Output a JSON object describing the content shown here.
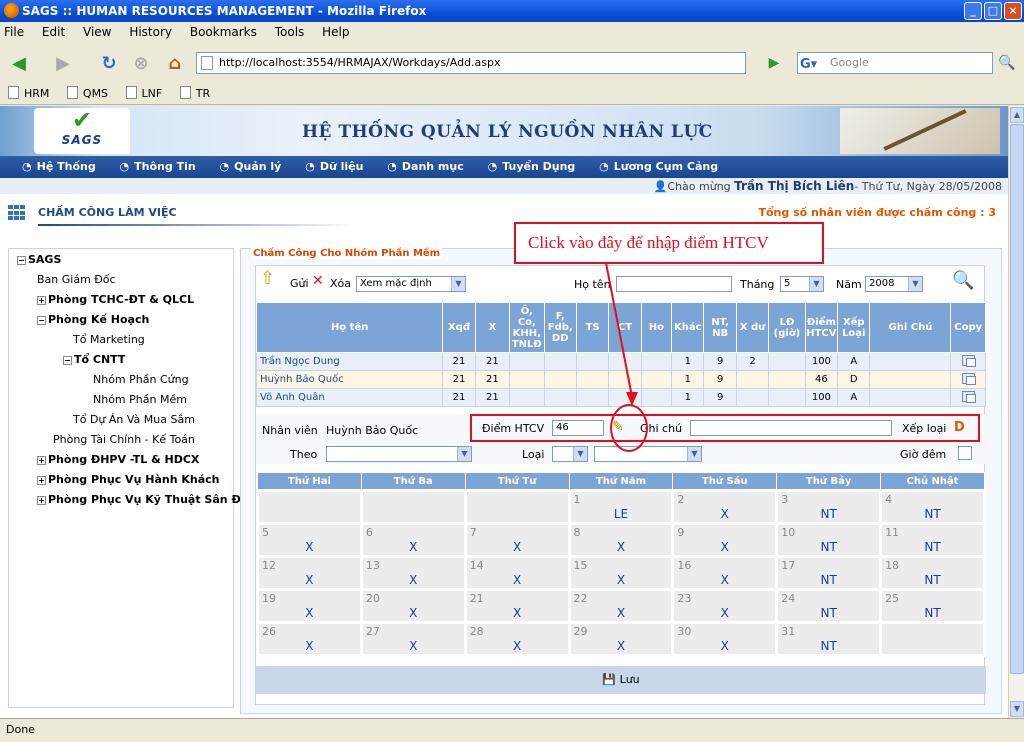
{
  "window": {
    "title": "SAGS :: HUMAN RESOURCES MANAGEMENT - Mozilla Firefox"
  },
  "menu": [
    "File",
    "Edit",
    "View",
    "History",
    "Bookmarks",
    "Tools",
    "Help"
  ],
  "address": {
    "url": "http://localhost:3554/HRMAJAX/Workdays/Add.aspx",
    "search_placeholder": "Google"
  },
  "bookmarks": [
    "HRM",
    "QMS",
    "LNF",
    "TR"
  ],
  "status": "Done",
  "banner": {
    "logo": "SAGS",
    "title": "HỆ THỐNG QUẢN LÝ NGUỒN NHÂN LỰC"
  },
  "topnav": [
    "Hệ Thống",
    "Thông Tin",
    "Quản lý",
    "Dữ liệu",
    "Danh mục",
    "Tuyển Dụng",
    "Lương Cụm Cảng"
  ],
  "welcome": {
    "prefix": "Chào mừng ",
    "name": "Trần Thị Bích Liên",
    "suffix": "- Thứ Tư, Ngày 28/05/2008"
  },
  "page": {
    "title": "CHẤM CÔNG LÀM VIỆC",
    "count_label": "Tổng số nhân viên được chấm công : 3"
  },
  "tree": [
    "SAGS",
    "Ban Giám Đốc",
    "Phòng TCHC-ĐT & QLCL",
    "Phòng Kế Hoạch",
    "Tổ Marketing",
    "Tổ CNTT",
    "Nhóm Phần Cứng",
    "Nhóm Phần Mềm",
    "Tổ Dự Án Và Mua Sắm",
    "Phòng Tài Chính - Kế Toán",
    "Phòng ĐHPV -TL & HDCX",
    "Phòng Phục Vụ Hành Khách",
    "Phòng Phục Vụ Kỹ Thuật Sân Đỗ"
  ],
  "panel": {
    "legend": "Chấm Công Cho Nhóm Phần Mềm",
    "send": "Gửi",
    "delete": "Xóa",
    "view_select": "Xem mặc định",
    "name_label": "Họ tên",
    "month_label": "Tháng",
    "month": "5",
    "year_label": "Năm",
    "year": "2008"
  },
  "table": {
    "headers": [
      "Họ tên",
      "Xqđ",
      "X",
      "Ô, Co, KHH, TNLĐ",
      "F, Fdb, DD",
      "TS",
      "CT",
      "Ho",
      "Khác",
      "NT, NB",
      "X dư",
      "LĐ (giờ)",
      "Điểm HTCV",
      "Xếp Loại",
      "Ghi Chú",
      "Copy"
    ],
    "rows": [
      [
        "Trần Ngọc Dung",
        "21",
        "21",
        "",
        "",
        "",
        "",
        "",
        "1",
        "9",
        "2",
        "",
        "100",
        "A",
        ""
      ],
      [
        "Huỳnh Bảo Quốc",
        "21",
        "21",
        "",
        "",
        "",
        "",
        "",
        "1",
        "9",
        "",
        "",
        "46",
        "D",
        ""
      ],
      [
        "Võ Anh Quân",
        "21",
        "21",
        "",
        "",
        "",
        "",
        "",
        "1",
        "9",
        "",
        "",
        "100",
        "A",
        ""
      ]
    ]
  },
  "edit": {
    "employee_label": "Nhân viên",
    "employee": "Huỳnh Bảo Quốc",
    "score_label": "Điểm HTCV",
    "score": "46",
    "note_label": "Ghi chú",
    "rank_label": "Xếp loại",
    "rank": "D",
    "follow_label": "Theo",
    "type_label": "Loại",
    "night_label": "Giờ đêm"
  },
  "calendar": {
    "days": [
      "Thứ Hai",
      "Thứ Ba",
      "Thứ Tư",
      "Thứ Năm",
      "Thứ Sáu",
      "Thứ Bảy",
      "Chủ Nhật"
    ],
    "weeks": [
      [
        [
          "",
          ""
        ],
        [
          "",
          ""
        ],
        [
          "",
          ""
        ],
        [
          "1",
          "LE"
        ],
        [
          "2",
          "X"
        ],
        [
          "3",
          "NT"
        ],
        [
          "4",
          "NT"
        ]
      ],
      [
        [
          "5",
          "X"
        ],
        [
          "6",
          "X"
        ],
        [
          "7",
          "X"
        ],
        [
          "8",
          "X"
        ],
        [
          "9",
          "X"
        ],
        [
          "10",
          "NT"
        ],
        [
          "11",
          "NT"
        ]
      ],
      [
        [
          "12",
          "X"
        ],
        [
          "13",
          "X"
        ],
        [
          "14",
          "X"
        ],
        [
          "15",
          "X"
        ],
        [
          "16",
          "X"
        ],
        [
          "17",
          "NT"
        ],
        [
          "18",
          "NT"
        ]
      ],
      [
        [
          "19",
          "X"
        ],
        [
          "20",
          "X"
        ],
        [
          "21",
          "X"
        ],
        [
          "22",
          "X"
        ],
        [
          "23",
          "X"
        ],
        [
          "24",
          "NT"
        ],
        [
          "25",
          "NT"
        ]
      ],
      [
        [
          "26",
          "X"
        ],
        [
          "27",
          "X"
        ],
        [
          "28",
          "X"
        ],
        [
          "29",
          "X"
        ],
        [
          "30",
          "X"
        ],
        [
          "31",
          "NT"
        ],
        [
          "",
          ""
        ]
      ]
    ]
  },
  "save_label": "Lưu",
  "callout": "Click vào đây để nhập điểm HTCV",
  "colors": {
    "header_blue": "#7da4d6",
    "nav_blue": "#1a4690",
    "accent_orange": "#e05800",
    "highlight_red": "#e0101a"
  }
}
